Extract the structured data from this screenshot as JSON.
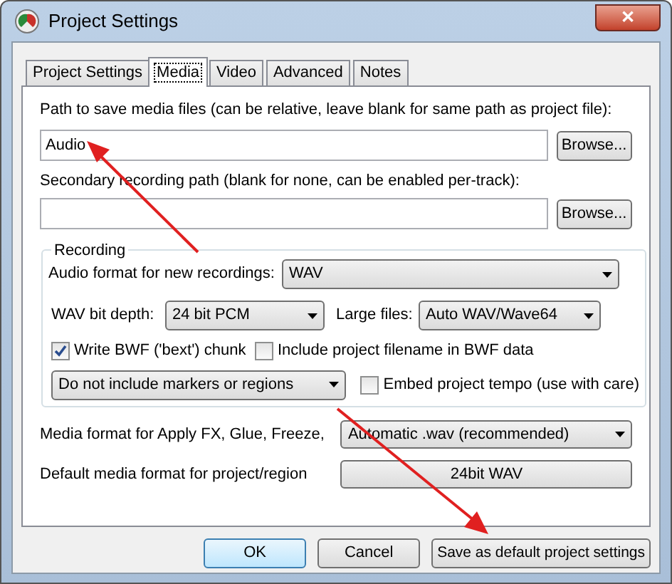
{
  "window": {
    "title": "Project Settings",
    "close": "✕"
  },
  "tabs": [
    {
      "label": "Project Settings",
      "selected": false
    },
    {
      "label": "Media",
      "selected": true
    },
    {
      "label": "Video",
      "selected": false
    },
    {
      "label": "Advanced",
      "selected": false
    },
    {
      "label": "Notes",
      "selected": false
    }
  ],
  "media_path": {
    "label": "Path to save media files (can be relative, leave blank for same path as project file):",
    "value": "Audio",
    "button": "Browse..."
  },
  "secondary_path": {
    "label": "Secondary recording path (blank for none, can be enabled per-track):",
    "button": "Browse..."
  },
  "recording": {
    "title": "Recording",
    "audio_format": {
      "label": "Audio format for new recordings:",
      "value": "WAV"
    },
    "bit_depth": {
      "label": "WAV bit depth:",
      "value": "24 bit PCM"
    },
    "large_files": {
      "label": "Large files:",
      "value": "Auto WAV/Wave64"
    },
    "write_bwf": {
      "label": "Write BWF ('bext') chunk",
      "checked": true
    },
    "include_filename": {
      "label": "Include project filename in BWF data",
      "checked": false
    },
    "markers": {
      "value": "Do not include markers or regions"
    },
    "embed_tempo": {
      "label": "Embed project tempo (use with care)",
      "checked": false
    }
  },
  "apply_fx_format": {
    "label": "Media format for Apply FX, Glue, Freeze,",
    "value": "Automatic .wav (recommended)"
  },
  "default_format": {
    "label": "Default media format for project/region",
    "button": "24bit WAV"
  },
  "buttons": [
    {
      "label": "OK",
      "default": true
    },
    {
      "label": "Cancel",
      "default": false
    },
    {
      "label": "Save as default project settings",
      "default": false
    }
  ]
}
